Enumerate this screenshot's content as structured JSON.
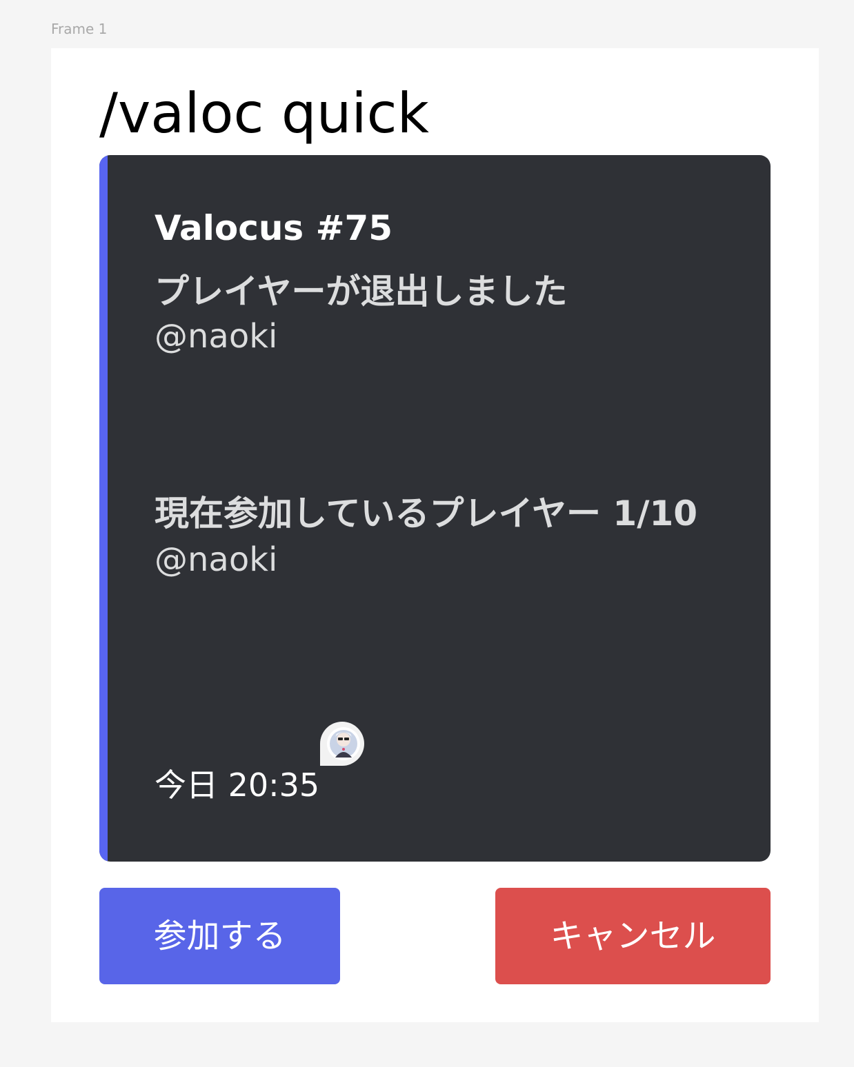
{
  "frame": {
    "label": "Frame 1"
  },
  "command": {
    "title": "/valoc quick"
  },
  "embed": {
    "title": "Valocus #75",
    "accent_color": "#5865f2",
    "background_color": "#2f3136",
    "fields": [
      {
        "name": "プレイヤーが退出しました",
        "value": "@naoki"
      },
      {
        "name": "現在参加しているプレイヤー 1/10",
        "value": "@naoki"
      }
    ],
    "footer": {
      "timestamp": "今日 20:35",
      "avatar_icon": "user-avatar-icon"
    }
  },
  "buttons": {
    "join_label": "参加する",
    "join_color": "#5865e8",
    "cancel_label": "キャンセル",
    "cancel_color": "#dc4f4d"
  }
}
